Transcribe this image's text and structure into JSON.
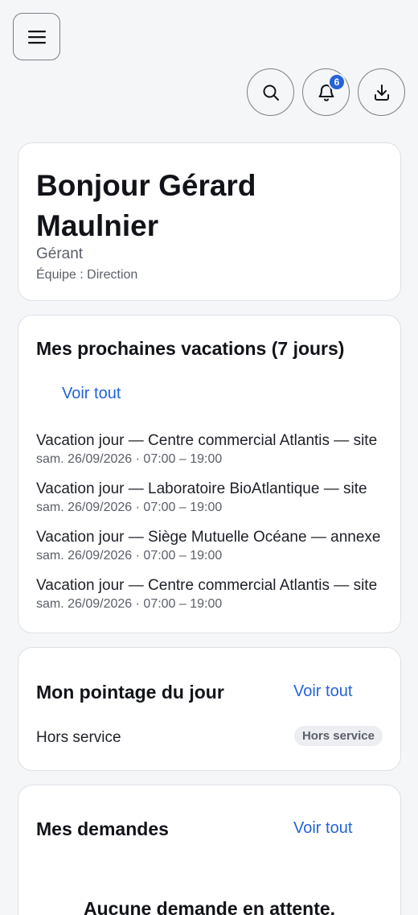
{
  "header": {
    "menu_icon": "hamburger-menu-icon",
    "search_icon": "search-icon",
    "notifications_icon": "bell-icon",
    "notifications_count": "6",
    "download_icon": "download-icon"
  },
  "greeting": {
    "title": "Bonjour Gérard Maulnier",
    "role": "Gérant",
    "team": "Équipe : Direction"
  },
  "shifts": {
    "title": "Mes prochaines vacations (7 jours)",
    "see_all": "Voir tout",
    "items": [
      {
        "title": "Vacation jour — Centre commercial Atlantis — site",
        "time": "sam. 26/09/2026 · 07:00 – 19:00"
      },
      {
        "title": "Vacation jour — Laboratoire BioAtlantique — site",
        "time": "sam. 26/09/2026 · 07:00 – 19:00"
      },
      {
        "title": "Vacation jour — Siège Mutuelle Océane — annexe",
        "time": "sam. 26/09/2026 · 07:00 – 19:00"
      },
      {
        "title": "Vacation jour — Centre commercial Atlantis — site",
        "time": "sam. 26/09/2026 · 07:00 – 19:00"
      }
    ]
  },
  "clock": {
    "title": "Mon pointage du jour",
    "see_all": "Voir tout",
    "status_text": "Hors service",
    "status_badge": "Hors service"
  },
  "requests": {
    "title": "Mes demandes",
    "see_all": "Voir tout",
    "empty_text": "Aucune demande en attente."
  },
  "colors": {
    "accent": "#2563d8",
    "background": "#f5f6f8",
    "card": "#ffffff"
  }
}
